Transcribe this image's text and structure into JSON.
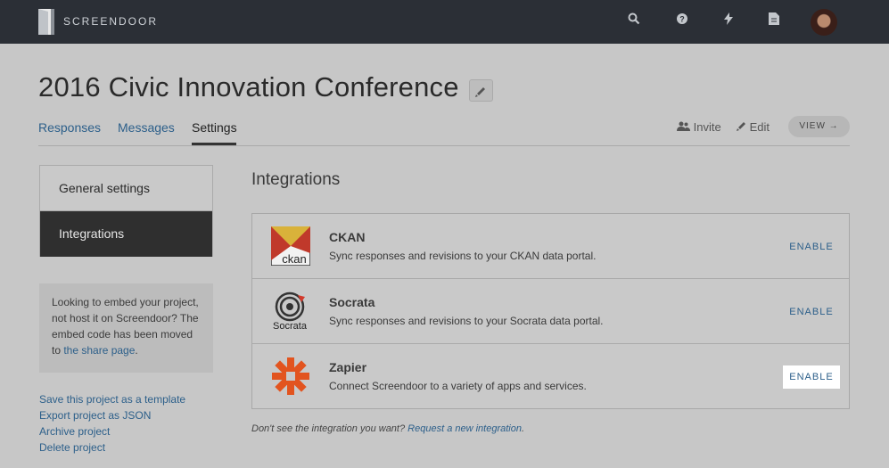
{
  "header": {
    "logo_text": "SCREENDOOR",
    "icons": [
      "search-icon",
      "help-icon",
      "bolt-icon",
      "document-icon"
    ]
  },
  "project": {
    "title": "2016 Civic Innovation Conference"
  },
  "tabs": [
    {
      "label": "Responses",
      "active": false
    },
    {
      "label": "Messages",
      "active": false
    },
    {
      "label": "Settings",
      "active": true
    }
  ],
  "actions": {
    "invite": "Invite",
    "edit": "Edit",
    "view": "VIEW →"
  },
  "sidebar": {
    "items": [
      {
        "label": "General settings"
      },
      {
        "label": "Integrations"
      }
    ],
    "embed_note": {
      "text": "Looking to embed your project, not host it on Screendoor? The embed code has been moved to ",
      "link": "the share page",
      "suffix": "."
    },
    "links": [
      {
        "label": "Save this project as a template"
      },
      {
        "label": "Export project as JSON"
      },
      {
        "label": "Archive project"
      },
      {
        "label": "Delete project"
      }
    ]
  },
  "main": {
    "title": "Integrations",
    "integrations": [
      {
        "name": "CKAN",
        "description": "Sync responses and revisions to your CKAN data portal.",
        "action": "ENABLE",
        "logo_text": "ckan"
      },
      {
        "name": "Socrata",
        "description": "Sync responses and revisions to your Socrata data portal.",
        "action": "ENABLE",
        "logo_text": "Socrata"
      },
      {
        "name": "Zapier",
        "description": "Connect Screendoor to a variety of apps and services.",
        "action": "ENABLE",
        "logo_text": ""
      }
    ],
    "footnote": {
      "text": "Don't see the integration you want? ",
      "link": "Request a new integration",
      "suffix": "."
    }
  },
  "colors": {
    "topbar": "#2b2f36",
    "link": "#2c5f8a",
    "zapier": "#e2541f",
    "ckan_red": "#c0392b",
    "ckan_yellow": "#d9b23a",
    "socrata_red": "#d2392b"
  }
}
